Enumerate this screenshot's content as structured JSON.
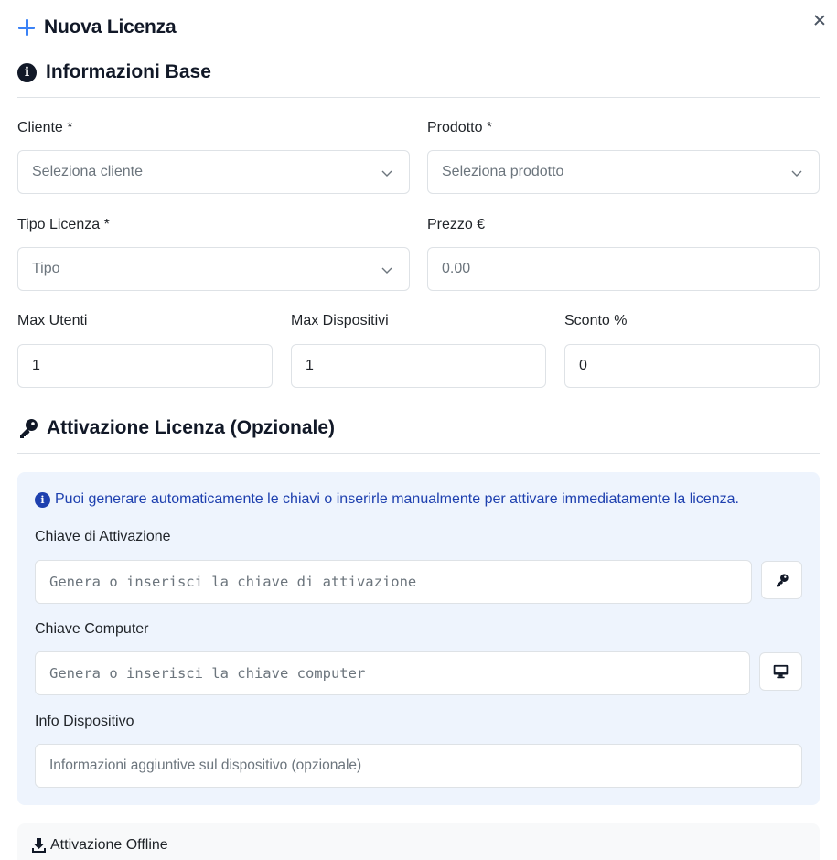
{
  "modal": {
    "title": "Nuova Licenza",
    "close_icon": "close-icon",
    "add_icon": "plus-icon",
    "accent_color": "#3b82f6"
  },
  "basic_info": {
    "title": "Informazioni Base",
    "icon": "info-circle-icon",
    "client": {
      "label": "Cliente *",
      "placeholder": "Seleziona cliente"
    },
    "product": {
      "label": "Prodotto *",
      "placeholder": "Seleziona prodotto"
    },
    "license_type": {
      "label": "Tipo Licenza *",
      "placeholder": "Tipo"
    },
    "price": {
      "label": "Prezzo €",
      "placeholder": "0.00"
    },
    "max_users": {
      "label": "Max Utenti",
      "value": "1"
    },
    "max_devices": {
      "label": "Max Dispositivi",
      "value": "1"
    },
    "discount": {
      "label": "Sconto %",
      "value": "0"
    }
  },
  "activation": {
    "title": "Attivazione Licenza (Opzionale)",
    "icon": "key-icon",
    "alert_text": "Puoi generare automaticamente le chiavi o inserirle manualmente per attivare immediatamente la licenza.",
    "alert_color": "#1e40af",
    "box_color": "#eef4fd",
    "activation_key": {
      "label": "Chiave di Attivazione",
      "placeholder": "Genera o inserisci la chiave di attivazione",
      "button_icon": "key-icon"
    },
    "computer_key": {
      "label": "Chiave Computer",
      "placeholder": "Genera o inserisci la chiave computer",
      "button_icon": "desktop-icon"
    },
    "device_info": {
      "label": "Info Dispositivo",
      "placeholder": "Informazioni aggiuntive sul dispositivo (opzionale)"
    }
  },
  "offline": {
    "title": "Attivazione Offline",
    "icon": "download-icon"
  }
}
